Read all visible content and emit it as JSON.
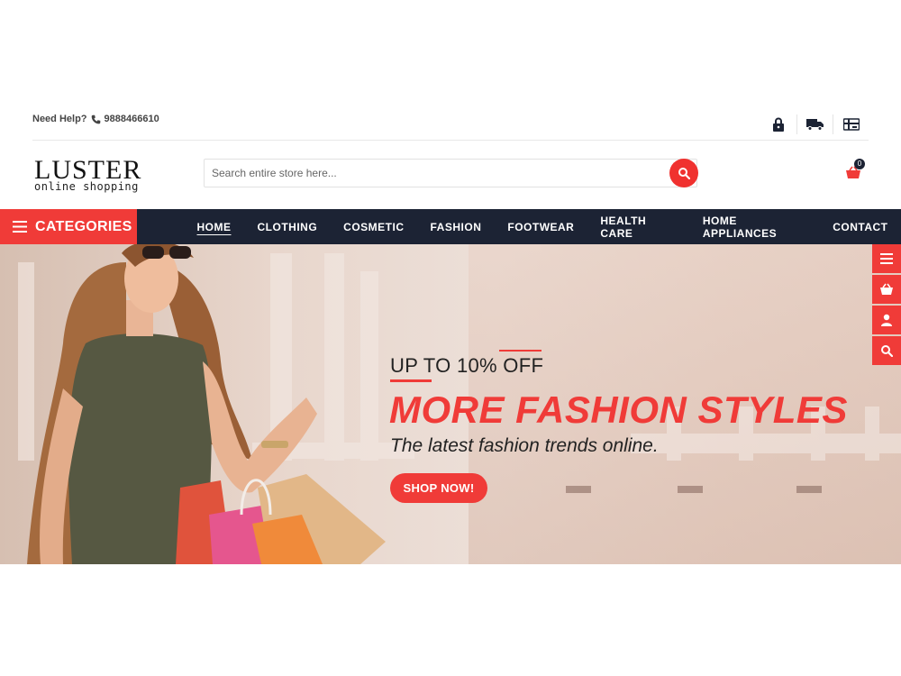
{
  "topbar": {
    "help_label": "Need Help?",
    "phone": "9888466610",
    "icons": [
      "lock-icon",
      "truck-icon",
      "gift-card-icon"
    ]
  },
  "header": {
    "logo_main": "LUSTER",
    "logo_sub": "online shopping",
    "search_placeholder": "Search entire store here...",
    "cart_count": "0"
  },
  "nav": {
    "categories_label": "CATEGORIES",
    "items": [
      "HOME",
      "CLOTHING",
      "COSMETIC",
      "FASHION",
      "FOOTWEAR",
      "HEALTH CARE",
      "HOME APPLIANCES",
      "CONTACT"
    ],
    "active": "HOME"
  },
  "banner": {
    "subtitle": "UP TO 10% OFF",
    "title": "MORE FASHION STYLES",
    "tagline": "The latest fashion trends online.",
    "button": "SHOP NOW!"
  },
  "side_widgets": [
    "menu-icon",
    "basket-icon",
    "user-icon",
    "search-icon"
  ],
  "colors": {
    "accent": "#f03b38",
    "nav_bg": "#1c2334"
  }
}
